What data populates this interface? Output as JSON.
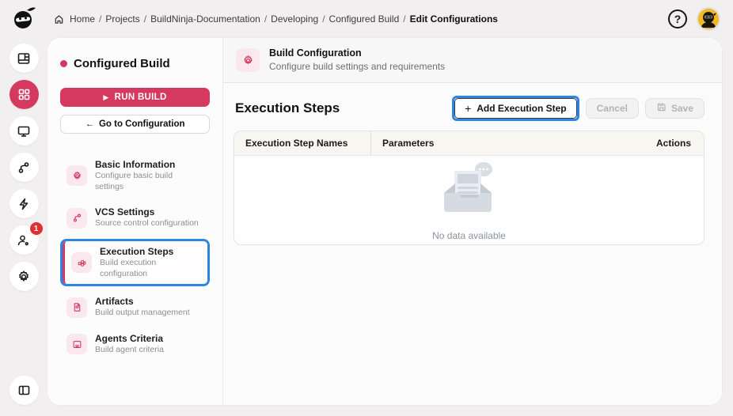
{
  "topbar": {
    "separator": "/",
    "help_label": "?",
    "breadcrumb": [
      {
        "label": "Home"
      },
      {
        "label": "Projects"
      },
      {
        "label": "BuildNinja-Documentation"
      },
      {
        "label": "Developing"
      },
      {
        "label": "Configured Build"
      },
      {
        "label": "Edit Configurations"
      }
    ]
  },
  "rail": {
    "notification_badge": "1",
    "items": [
      {
        "icon": "layout-dashboard-icon",
        "active": false
      },
      {
        "icon": "grid-apps-icon",
        "active": true
      },
      {
        "icon": "monitor-icon",
        "active": false
      },
      {
        "icon": "git-branch-icon",
        "active": false
      },
      {
        "icon": "lightning-icon",
        "active": false
      },
      {
        "icon": "user-gear-icon",
        "active": false,
        "badge": "1"
      },
      {
        "icon": "settings-gear-icon",
        "active": false
      }
    ],
    "bottom_item": {
      "icon": "panel-toggle-icon"
    }
  },
  "icons": {
    "play": "▶",
    "arrow_left": "←",
    "plus": "+"
  },
  "sidebar": {
    "project_title": "Configured Build",
    "run_button": "RUN BUILD",
    "goto_button": "Go to Configuration",
    "nav": [
      {
        "title": "Basic Information",
        "subtitle": "Configure basic build settings",
        "icon": "gear-icon",
        "active": false
      },
      {
        "title": "VCS Settings",
        "subtitle": "Source control configuration",
        "icon": "git-branch-icon",
        "active": false
      },
      {
        "title": "Execution Steps",
        "subtitle": "Build execution configuration",
        "icon": "blocks-icon",
        "active": true,
        "annotated": true
      },
      {
        "title": "Artifacts",
        "subtitle": "Build output management",
        "icon": "file-icon",
        "active": false
      },
      {
        "title": "Agents Criteria",
        "subtitle": "Build agent criteria",
        "icon": "agent-monitor-icon",
        "active": false
      }
    ]
  },
  "main": {
    "header": {
      "title": "Build Configuration",
      "subtitle": "Configure build settings and requirements",
      "icon": "gear-icon"
    },
    "section": {
      "title": "Execution Steps",
      "add_button": "Add Execution Step",
      "cancel_button": "Cancel",
      "save_button": "Save",
      "add_button_annotated": true
    },
    "table": {
      "columns": [
        "Execution Step Names",
        "Parameters",
        "Actions"
      ],
      "rows": [],
      "empty_text": "No data available"
    }
  },
  "colors": {
    "accent": "#d5395f",
    "accent_soft": "#fbe7ee",
    "annotation_blue": "#2b87e3",
    "badge_red": "#e03131",
    "avatar_yellow": "#f2b924",
    "page_bg": "#f1efef",
    "table_header_bg": "#f8f6f1"
  }
}
